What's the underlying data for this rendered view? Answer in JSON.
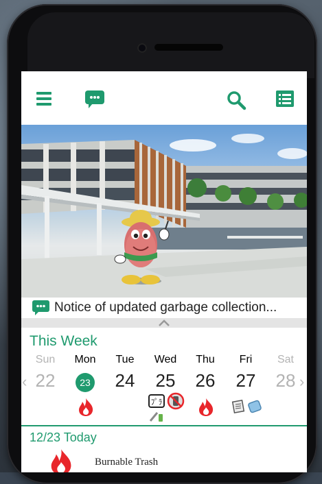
{
  "colors": {
    "accent": "#1f9a6e",
    "fire": "#e8262b",
    "muted": "#b3b3b3"
  },
  "toolbar": {
    "icons": [
      "menu-icon",
      "chat-bubble-icon",
      "search-icon",
      "list-icon"
    ]
  },
  "notice": {
    "icon": "chat-bubble-icon",
    "text": "Notice of updated garbage collection..."
  },
  "week": {
    "title": "This Week",
    "days": [
      {
        "name": "Sun",
        "date": "22",
        "state": "muted",
        "items": []
      },
      {
        "name": "Mon",
        "date": "23",
        "state": "today",
        "items": [
          "burnable-icon"
        ]
      },
      {
        "name": "Tue",
        "date": "24",
        "state": "normal",
        "items": []
      },
      {
        "name": "Wed",
        "date": "25",
        "state": "normal",
        "items": [
          "recycle-icon",
          "no-plastic-icon",
          "pen-battery-icon"
        ]
      },
      {
        "name": "Thu",
        "date": "26",
        "state": "normal",
        "items": [
          "burnable-icon"
        ]
      },
      {
        "name": "Fri",
        "date": "27",
        "state": "normal",
        "items": [
          "newspaper-icon",
          "bottle-icon"
        ]
      },
      {
        "name": "Sat",
        "date": "28",
        "state": "muted",
        "items": []
      }
    ],
    "prev_arrow": "‹",
    "next_arrow": "›"
  },
  "today": {
    "date_label": "12/23 Today",
    "items": [
      {
        "icon": "burnable-icon",
        "label": "Burnable Trash"
      }
    ]
  }
}
